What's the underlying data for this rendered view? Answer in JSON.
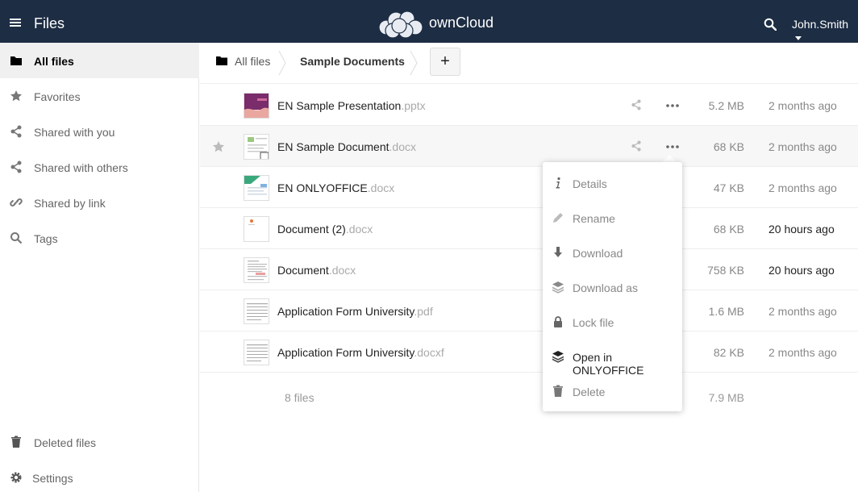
{
  "header": {
    "app_title": "Files",
    "brand": "ownCloud",
    "user": "John.Smith",
    "bg_color": "#1d2d44"
  },
  "sidebar": {
    "items": [
      {
        "label": "All files",
        "icon": "folder-icon",
        "active": true
      },
      {
        "label": "Favorites",
        "icon": "star-icon"
      },
      {
        "label": "Shared with you",
        "icon": "share-icon"
      },
      {
        "label": "Shared with others",
        "icon": "share-icon"
      },
      {
        "label": "Shared by link",
        "icon": "link-icon"
      },
      {
        "label": "Tags",
        "icon": "tag-search-icon"
      }
    ],
    "deleted": "Deleted files",
    "settings": "Settings"
  },
  "breadcrumb": {
    "root": "All files",
    "current": "Sample Documents",
    "add_label": "+"
  },
  "files": [
    {
      "name": "EN Sample Presentation",
      "ext": ".pptx",
      "size": "5.2 MB",
      "modified": "2 months ago",
      "recent": false
    },
    {
      "name": "EN Sample Document",
      "ext": ".docx",
      "size": "68 KB",
      "modified": "2 months ago",
      "recent": false
    },
    {
      "name": "EN ONLYOFFICE",
      "ext": ".docx",
      "size": "47 KB",
      "modified": "2 months ago",
      "recent": false
    },
    {
      "name": "Document (2)",
      "ext": ".docx",
      "size": "68 KB",
      "modified": "20 hours ago",
      "recent": true
    },
    {
      "name": "Document",
      "ext": ".docx",
      "size": "758 KB",
      "modified": "20 hours ago",
      "recent": true
    },
    {
      "name": "Application Form University",
      "ext": ".pdf",
      "size": "1.6 MB",
      "modified": "2 months ago",
      "recent": false
    },
    {
      "name": "Application Form University",
      "ext": ".docxf",
      "size": "82 KB",
      "modified": "2 months ago",
      "recent": false
    }
  ],
  "summary": {
    "count": "8 files",
    "total_size": "7.9 MB"
  },
  "context_menu": {
    "items": [
      {
        "label": "Details",
        "icon": "info-icon"
      },
      {
        "label": "Rename",
        "icon": "pencil-icon"
      },
      {
        "label": "Download",
        "icon": "download-arrow-icon"
      },
      {
        "label": "Download as",
        "icon": "layers-icon"
      },
      {
        "label": "Lock file",
        "icon": "lock-icon"
      },
      {
        "label": "Open in ONLYOFFICE",
        "icon": "layers-icon"
      },
      {
        "label": "Delete",
        "icon": "trash-icon"
      }
    ]
  }
}
